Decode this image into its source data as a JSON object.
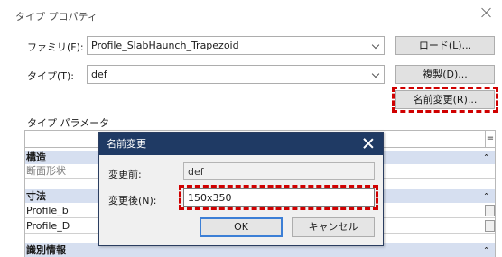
{
  "window": {
    "title": "タイプ プロパティ"
  },
  "family": {
    "label": "ファミリ(F):",
    "value": "Profile_SlabHaunch_Trapezoid",
    "load_button": "ロード(L)..."
  },
  "type": {
    "label": "タイプ(T):",
    "value": "def",
    "duplicate_button": "複製(D)...",
    "rename_button": "名前変更(R)..."
  },
  "type_params": {
    "label": "タイプ パラメータ"
  },
  "grid": {
    "eq_symbol": "=",
    "groups": [
      {
        "label": "構造",
        "caret": "⌃"
      },
      {
        "label": "寸法",
        "caret": "⌃"
      },
      {
        "label": "識別情報",
        "caret": "⌃"
      }
    ],
    "rows": [
      "断面形状",
      "Profile_b",
      "Profile_D"
    ]
  },
  "rename_dialog": {
    "title": "名前変更",
    "before_label": "変更前:",
    "before_value": "def",
    "after_label": "変更後(N):",
    "after_value": "150x350",
    "ok_label": "OK",
    "cancel_label": "キャンセル"
  },
  "colors": {
    "dialog_title_bg": "#1f3a64",
    "group_bg": "#d6dff0",
    "highlight": "#d00000"
  }
}
